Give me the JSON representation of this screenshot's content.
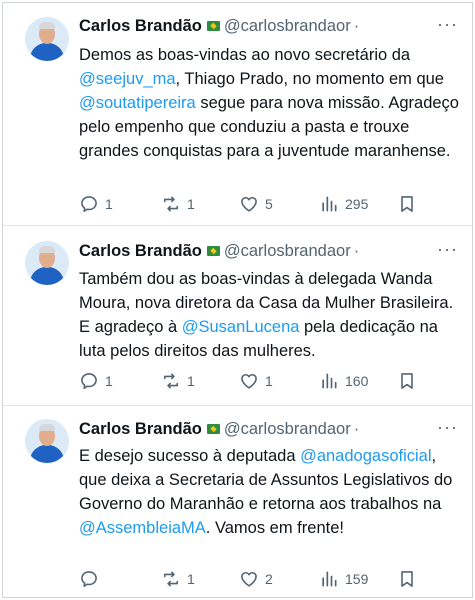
{
  "tweets": [
    {
      "author": {
        "name": "Carlos Brandão",
        "handle": "@carlosbrandaor"
      },
      "separator": "·",
      "more_label": "···",
      "body_segments": [
        {
          "text": "Demos as boas-vindas ao novo secretário da ",
          "mention": false
        },
        {
          "text": "@seejuv_ma",
          "mention": true
        },
        {
          "text": ", Thiago Prado, no momento em que ",
          "mention": false
        },
        {
          "text": "@soutatipereira",
          "mention": true
        },
        {
          "text": " segue para nova missão. Agradeço pelo empenho que conduziu a pasta e trouxe grandes conquistas para a juventude maranhense.",
          "mention": false
        }
      ],
      "replies": "1",
      "reposts": "1",
      "likes": "5",
      "views": "295"
    },
    {
      "author": {
        "name": "Carlos Brandão",
        "handle": "@carlosbrandaor"
      },
      "separator": "·",
      "more_label": "···",
      "body_segments": [
        {
          "text": "Também dou as boas-vindas à delegada Wanda Moura, nova diretora da Casa da Mulher Brasileira. E agradeço à ",
          "mention": false
        },
        {
          "text": "@SusanLucena",
          "mention": true
        },
        {
          "text": " pela dedicação na luta pelos direitos das mulheres.",
          "mention": false
        }
      ],
      "replies": "1",
      "reposts": "1",
      "likes": "1",
      "views": "160"
    },
    {
      "author": {
        "name": "Carlos Brandão",
        "handle": "@carlosbrandaor"
      },
      "separator": "·",
      "more_label": "···",
      "body_segments": [
        {
          "text": "E desejo sucesso à deputada ",
          "mention": false
        },
        {
          "text": "@anadogasoficial",
          "mention": true
        },
        {
          "text": ", que deixa a Secretaria de Assuntos Legislativos do Governo do Maranhão e retorna aos trabalhos na ",
          "mention": false
        },
        {
          "text": "@AssembleiaMA",
          "mention": true
        },
        {
          "text": ". Vamos em frente!",
          "mention": false
        }
      ],
      "replies": "",
      "reposts": "1",
      "likes": "2",
      "views": "159"
    }
  ],
  "icons": {
    "reply": "reply-icon",
    "repost": "repost-icon",
    "like": "heart-icon",
    "views": "views-chart-icon",
    "bookmark": "bookmark-icon",
    "flag": "brazil-flag-icon"
  },
  "colors": {
    "text": "#0f1419",
    "secondary": "#536471",
    "mention": "#1d9bf0"
  }
}
